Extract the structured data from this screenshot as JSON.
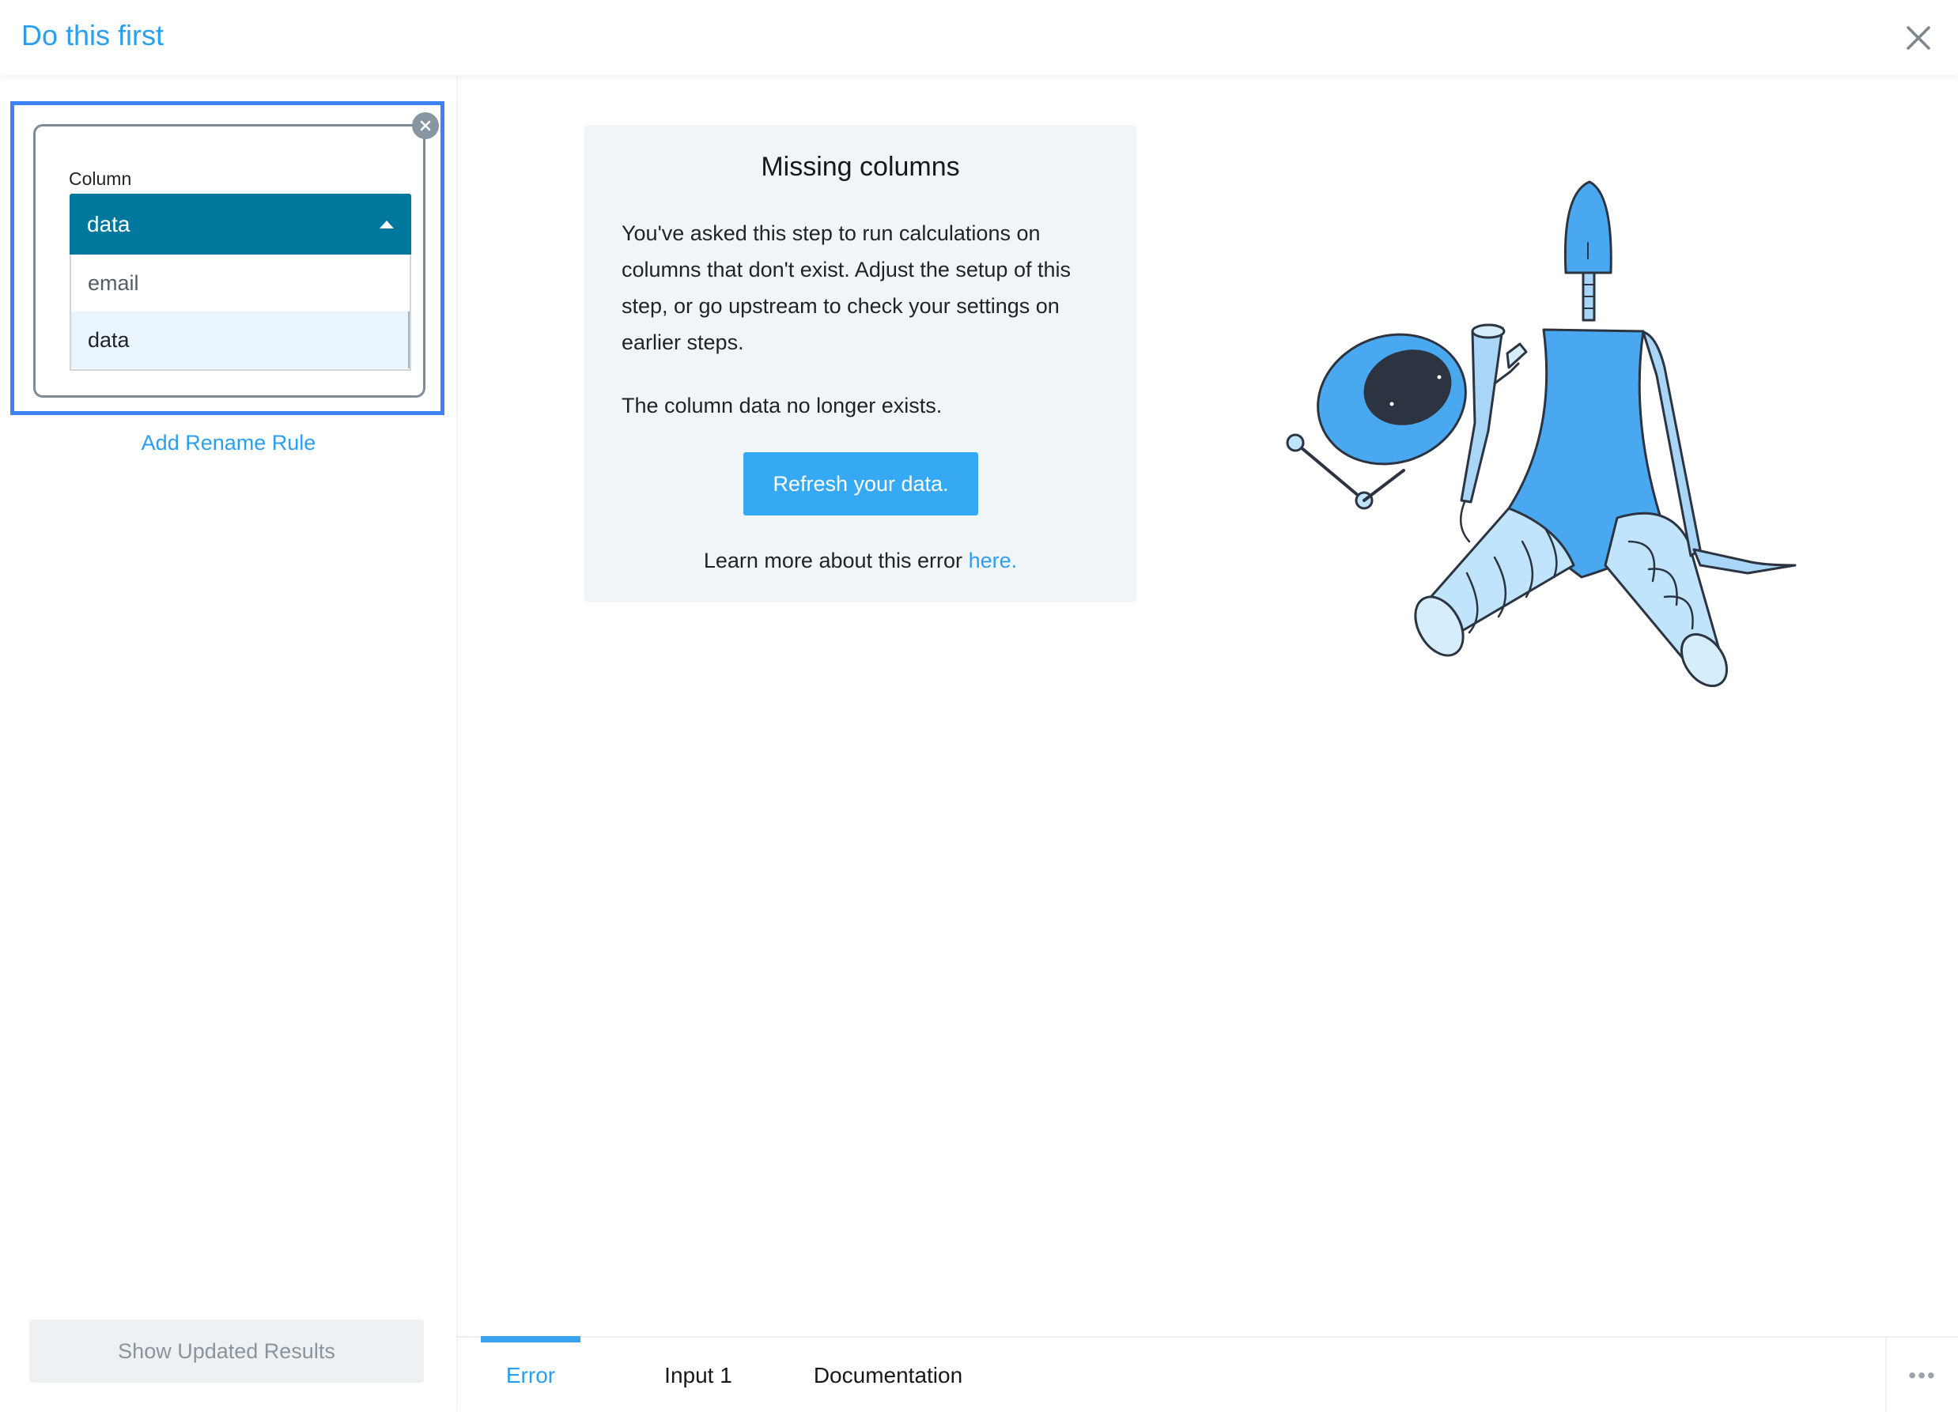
{
  "header": {
    "title": "Do this first"
  },
  "icons": {
    "close": "close-icon",
    "remove_rule": "remove-rule-icon",
    "caret": "caret-up-icon",
    "more": "more-horizontal-icon"
  },
  "colors": {
    "accent": "#2a9ff0",
    "select_bg": "#00789e",
    "focus_ring": "#3b82f6",
    "primary_button": "#36a9f5"
  },
  "sidebar": {
    "rule": {
      "field_label": "Column",
      "selected_value": "data",
      "options": [
        "email",
        "data"
      ]
    },
    "add_rule_label": "Add Rename Rule",
    "show_results_label": "Show Updated Results"
  },
  "error": {
    "title": "Missing columns",
    "body": "You've asked this step to run calculations on columns that don't exist. Adjust the setup of this step, or go upstream to check your settings on earlier steps.",
    "detail": "The column data no longer exists.",
    "refresh_label": "Refresh your data.",
    "learn_more_prefix": "Learn more about this error",
    "learn_more_link": "here."
  },
  "tabs": {
    "items": [
      "Error",
      "Input 1",
      "Documentation"
    ],
    "active": "Error",
    "more_label": "•••"
  }
}
